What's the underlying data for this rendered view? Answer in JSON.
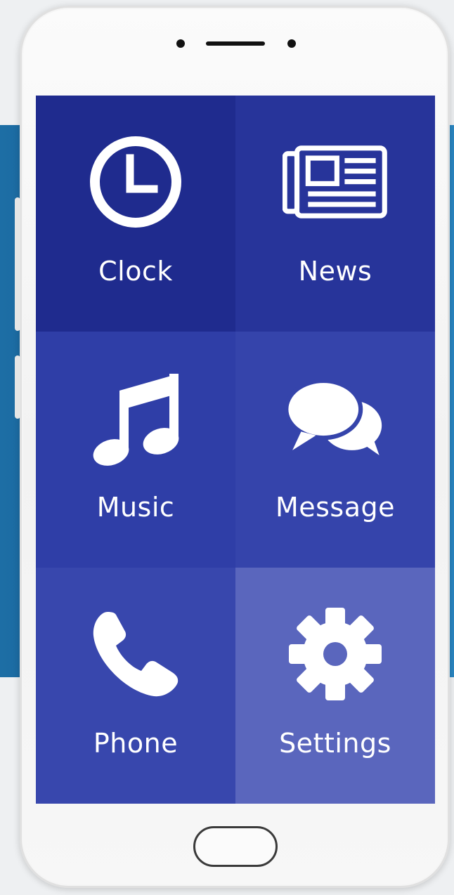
{
  "tiles": [
    {
      "id": "clock",
      "label": "Clock",
      "icon": "clock-icon",
      "color": "#1f2b8e"
    },
    {
      "id": "news",
      "label": "News",
      "icon": "newspaper-icon",
      "color": "#27349a"
    },
    {
      "id": "music",
      "label": "Music",
      "icon": "music-note-icon",
      "color": "#2f3ea7"
    },
    {
      "id": "message",
      "label": "Message",
      "icon": "chat-bubbles-icon",
      "color": "#3544ab"
    },
    {
      "id": "phone",
      "label": "Phone",
      "icon": "phone-icon",
      "color": "#3847ad"
    },
    {
      "id": "settings",
      "label": "Settings",
      "icon": "gear-icon",
      "color": "#5a66bd"
    }
  ],
  "colors": {
    "icon": "#ffffff",
    "background_band": "#1d6ea5"
  }
}
